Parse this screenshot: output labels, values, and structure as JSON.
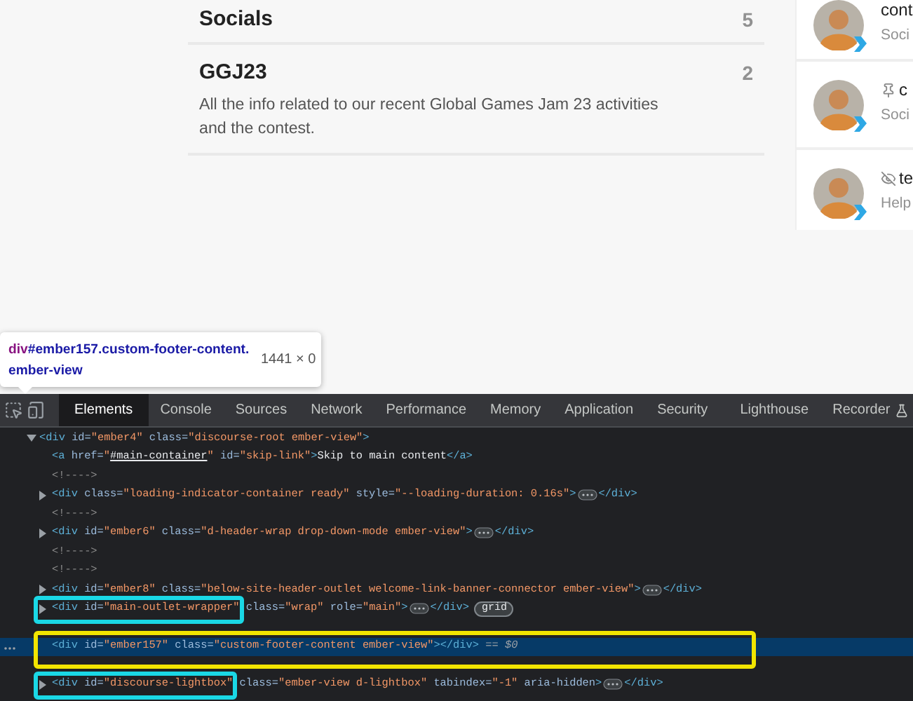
{
  "categories": [
    {
      "name": "Socials",
      "count": "5"
    },
    {
      "name": "GGJ23",
      "count": "2",
      "description": "All the info related to our recent Global Games Jam 23 activities and the contest."
    }
  ],
  "topics": [
    {
      "kind": "plain",
      "title": "cont",
      "subtitle": "Soci"
    },
    {
      "kind": "pinned",
      "title": "c",
      "subtitle": "Soci"
    },
    {
      "kind": "unlisted",
      "title": "te",
      "subtitle": "Help"
    }
  ],
  "tooltip": {
    "tag": "div",
    "selector": "#ember157.custom-footer-content.ember-view",
    "size": "1441 × 0"
  },
  "devtools": {
    "tabs": [
      {
        "label": "Elements",
        "selected": true
      },
      {
        "label": "Console",
        "selected": false
      },
      {
        "label": "Sources",
        "selected": false
      },
      {
        "label": "Network",
        "selected": false
      },
      {
        "label": "Performance",
        "selected": false
      },
      {
        "label": "Memory",
        "selected": false
      },
      {
        "label": "Application",
        "selected": false
      },
      {
        "label": "Security",
        "selected": false
      },
      {
        "label": "Lighthouse",
        "selected": false
      },
      {
        "label": "Recorder",
        "selected": false,
        "experimental": true
      }
    ],
    "tree": [
      {
        "expanded": true,
        "selected": false,
        "tokens": [
          {
            "kind": "tag",
            "text": "<div"
          },
          {
            "kind": "attr",
            "text": " id="
          },
          {
            "kind": "value",
            "text": "\"ember4\""
          },
          {
            "kind": "attr",
            "text": " class="
          },
          {
            "kind": "value",
            "text": "\"discourse-root ember-view\""
          },
          {
            "kind": "tag",
            "text": ">"
          }
        ],
        "children": [
          {
            "selected": false,
            "tokens": [
              {
                "kind": "tag",
                "text": "<a"
              },
              {
                "kind": "attr",
                "text": " href="
              },
              {
                "kind": "value",
                "text": "\""
              },
              {
                "kind": "link",
                "text": "#main-container"
              },
              {
                "kind": "value",
                "text": "\""
              },
              {
                "kind": "attr",
                "text": " id="
              },
              {
                "kind": "value",
                "text": "\"skip-link\""
              },
              {
                "kind": "tag",
                "text": ">"
              },
              {
                "kind": "text",
                "text": "Skip to main content"
              },
              {
                "kind": "tag",
                "text": "</a>"
              }
            ]
          },
          {
            "selected": false,
            "tokens": [
              {
                "kind": "comment",
                "text": "<!---->"
              }
            ]
          },
          {
            "expanded": false,
            "selected": false,
            "tokens": [
              {
                "kind": "tag",
                "text": "<div"
              },
              {
                "kind": "attr",
                "text": " class="
              },
              {
                "kind": "value",
                "text": "\"loading-indicator-container ready\""
              },
              {
                "kind": "attr",
                "text": " style="
              },
              {
                "kind": "value",
                "text": "\"--loading-duration: 0.16s\""
              },
              {
                "kind": "tag",
                "text": ">"
              },
              {
                "kind": "ellipsis"
              },
              {
                "kind": "tag",
                "text": "</div>"
              }
            ]
          },
          {
            "selected": false,
            "tokens": [
              {
                "kind": "comment",
                "text": "<!---->"
              }
            ]
          },
          {
            "expanded": false,
            "selected": false,
            "tokens": [
              {
                "kind": "tag",
                "text": "<div"
              },
              {
                "kind": "attr",
                "text": " id="
              },
              {
                "kind": "value",
                "text": "\"ember6\""
              },
              {
                "kind": "attr",
                "text": " class="
              },
              {
                "kind": "value",
                "text": "\"d-header-wrap drop-down-mode ember-view\""
              },
              {
                "kind": "tag",
                "text": ">"
              },
              {
                "kind": "ellipsis"
              },
              {
                "kind": "tag",
                "text": "</div>"
              }
            ]
          },
          {
            "selected": false,
            "tokens": [
              {
                "kind": "comment",
                "text": "<!---->"
              }
            ]
          },
          {
            "selected": false,
            "tokens": [
              {
                "kind": "comment",
                "text": "<!---->"
              }
            ]
          },
          {
            "expanded": false,
            "selected": false,
            "tokens": [
              {
                "kind": "tag",
                "text": "<div"
              },
              {
                "kind": "attr",
                "text": " id="
              },
              {
                "kind": "value",
                "text": "\"ember8\""
              },
              {
                "kind": "attr",
                "text": " class="
              },
              {
                "kind": "value",
                "text": "\"below-site-header-outlet welcome-link-banner-connector ember-view\""
              },
              {
                "kind": "tag",
                "text": ">"
              },
              {
                "kind": "ellipsis"
              },
              {
                "kind": "tag",
                "text": "</div>"
              }
            ]
          },
          {
            "expanded": false,
            "selected": false,
            "color": "#1ad8e6",
            "boxed": [
              {
                "kind": "tag",
                "text": "<div"
              },
              {
                "kind": "attr",
                "text": " id="
              },
              {
                "kind": "value",
                "text": "\"main-outlet-wrapper\""
              }
            ],
            "tokens": [
              {
                "kind": "attr",
                "text": " class="
              },
              {
                "kind": "value",
                "text": "\"wrap\""
              },
              {
                "kind": "attr",
                "text": " role="
              },
              {
                "kind": "value",
                "text": "\"main\""
              },
              {
                "kind": "tag",
                "text": ">"
              },
              {
                "kind": "ellipsis"
              },
              {
                "kind": "tag",
                "text": "</div>"
              },
              {
                "kind": "badge",
                "text": "grid"
              }
            ]
          },
          {
            "selected": true,
            "color": "#f2e500",
            "boxed": [
              {
                "kind": "tag",
                "text": "<div"
              },
              {
                "kind": "attr",
                "text": " id="
              },
              {
                "kind": "value",
                "text": "\"ember157\""
              },
              {
                "kind": "attr",
                "text": " class="
              },
              {
                "kind": "value",
                "text": "\"custom-footer-content ember-view\""
              },
              {
                "kind": "tag",
                "text": "></div>"
              },
              {
                "kind": "marker",
                "text": " == $0"
              }
            ]
          },
          {
            "expanded": false,
            "selected": false,
            "color": "#1ad8e6",
            "boxed": [
              {
                "kind": "tag",
                "text": "<div"
              },
              {
                "kind": "attr",
                "text": " id="
              },
              {
                "kind": "value",
                "text": "\"discourse-lightbox\""
              }
            ],
            "tokens": [
              {
                "kind": "attr",
                "text": " class="
              },
              {
                "kind": "value",
                "text": "\"ember-view d-lightbox\""
              },
              {
                "kind": "attr",
                "text": " tabindex="
              },
              {
                "kind": "value",
                "text": "\"-1\""
              },
              {
                "kind": "attr",
                "text": " aria-hidden"
              },
              {
                "kind": "tag",
                "text": ">"
              },
              {
                "kind": "ellipsis"
              },
              {
                "kind": "tag",
                "text": "</div>"
              }
            ]
          }
        ]
      }
    ]
  }
}
